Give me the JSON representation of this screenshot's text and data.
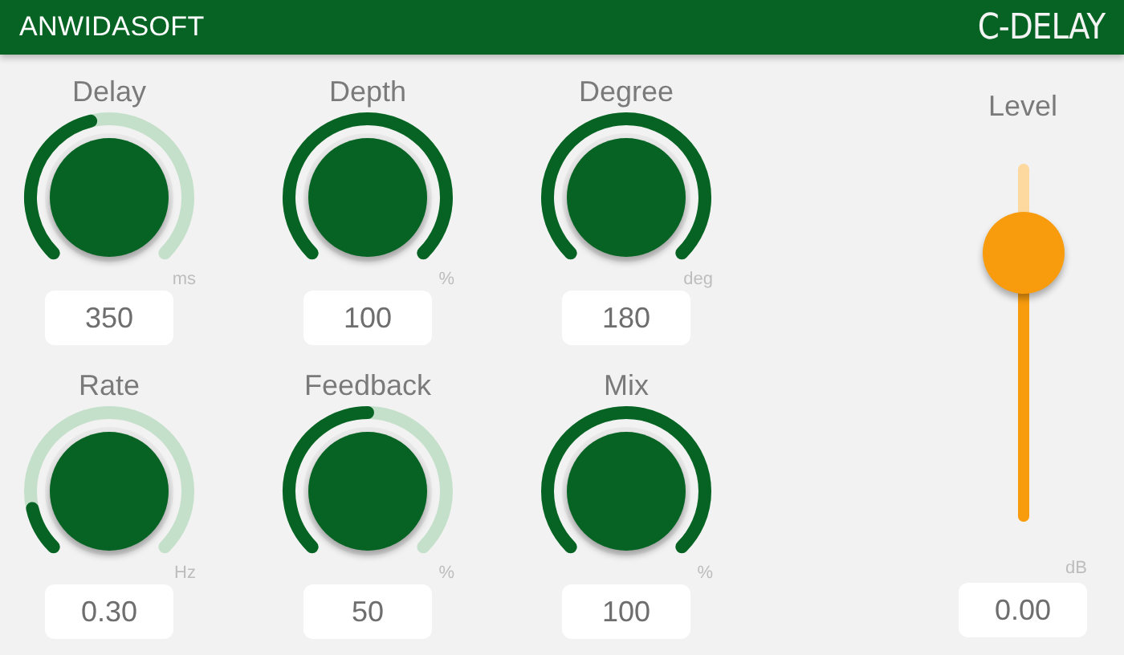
{
  "header": {
    "logo": "ANWIDASOFT",
    "title": "C-DELAY"
  },
  "knobs": [
    {
      "label": "Delay",
      "unit": "ms",
      "value": "350"
    },
    {
      "label": "Depth",
      "unit": "%",
      "value": "100"
    },
    {
      "label": "Degree",
      "unit": "deg",
      "value": "180"
    },
    {
      "label": "Rate",
      "unit": "Hz",
      "value": "0.30"
    },
    {
      "label": "Feedback",
      "unit": "%",
      "value": "50"
    },
    {
      "label": "Mix",
      "unit": "%",
      "value": "100"
    }
  ],
  "level_slider": {
    "label": "Level",
    "level": 0.75,
    "unit": "dB",
    "value": "0.00"
  }
}
